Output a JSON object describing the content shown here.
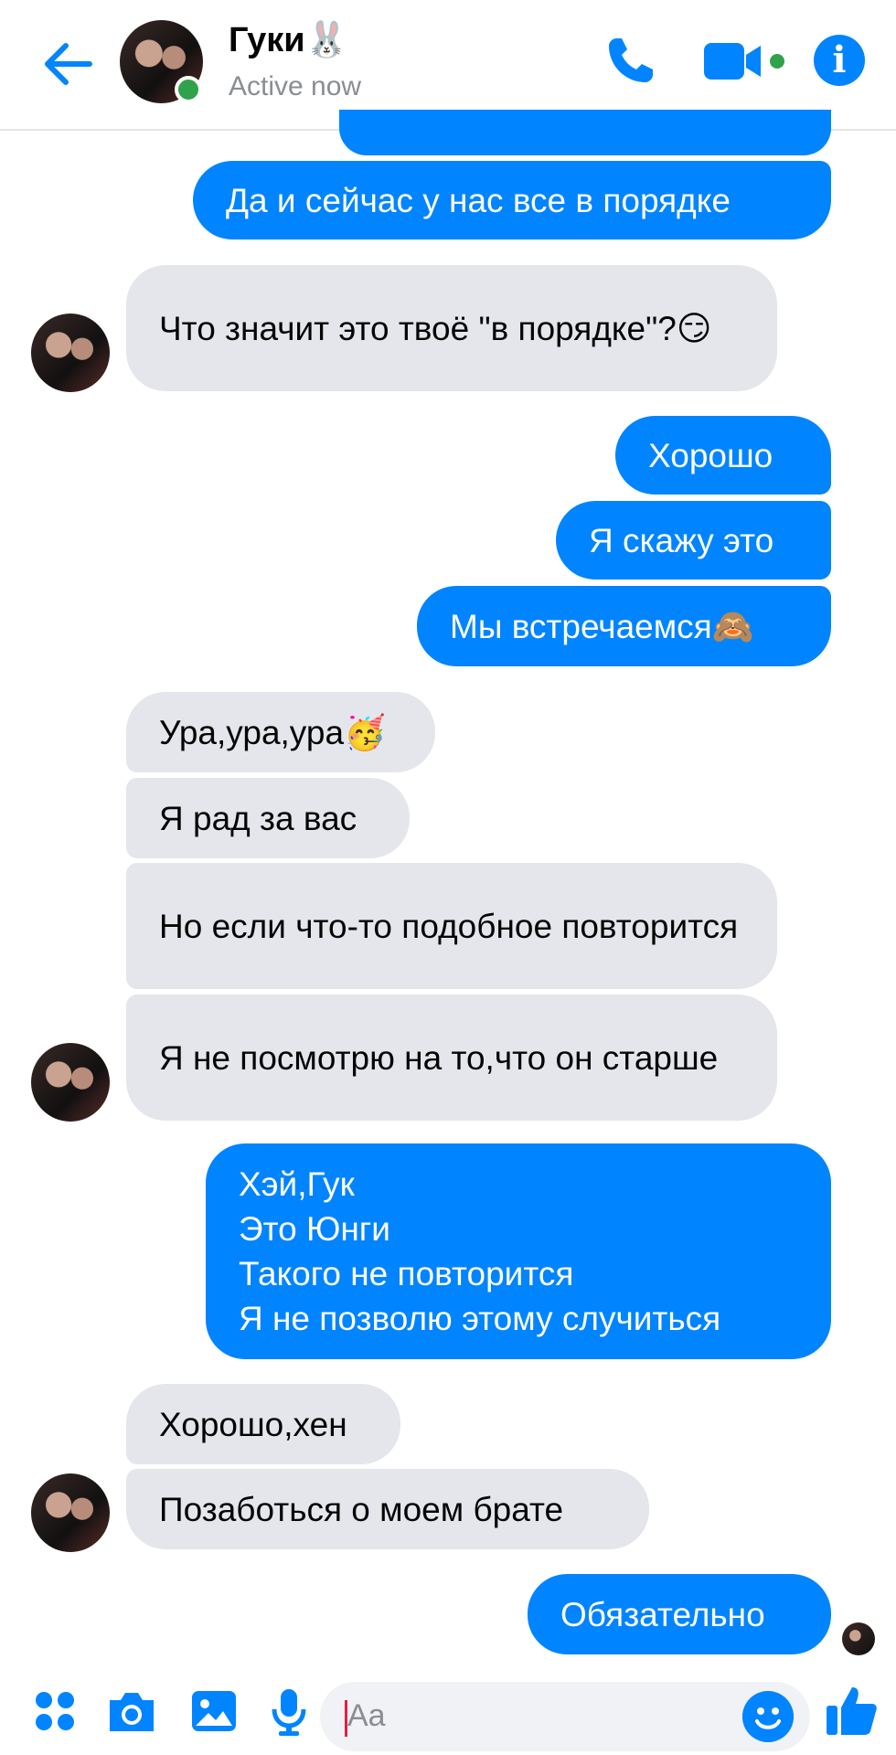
{
  "header": {
    "contact_name": "Гуки🐰",
    "status": "Active now",
    "info_glyph": "i",
    "icons": [
      "back-arrow-icon",
      "phone-icon",
      "video-camera-icon",
      "info-icon"
    ],
    "accent_color": "#0084ff",
    "online_color": "#31a24c"
  },
  "messages": [
    {
      "side": "out",
      "text": ""
    },
    {
      "side": "out",
      "text": "Да и сейчас у нас все в порядке"
    },
    {
      "side": "in",
      "text": "Что значит это твоё \"в порядке\"?😏"
    },
    {
      "side": "out",
      "text": "Хорошо"
    },
    {
      "side": "out",
      "text": "Я скажу это"
    },
    {
      "side": "out",
      "text": "Мы встречаемся🙈"
    },
    {
      "side": "in",
      "text": "Ура,ура,ура🥳"
    },
    {
      "side": "in",
      "text": "Я рад за вас"
    },
    {
      "side": "in",
      "text": "Но если что-то подобное повторится"
    },
    {
      "side": "in",
      "text": "Я не посмотрю на то,что он старше"
    },
    {
      "side": "out",
      "text": "Хэй,Гук\nЭто Юнги\nТакого не повторится\nЯ не позволю этому случиться"
    },
    {
      "side": "in",
      "text": "Хорошо,хен"
    },
    {
      "side": "in",
      "text": "Позаботься о моем брате"
    },
    {
      "side": "out",
      "text": "Обязательно"
    }
  ],
  "composer": {
    "placeholder": "Aa",
    "icons": [
      "apps-icon",
      "camera-icon",
      "gallery-icon",
      "microphone-icon",
      "emoji-icon",
      "thumbs-up-icon"
    ]
  },
  "colors": {
    "outgoing_bubble": "#0084ff",
    "incoming_bubble": "#e4e6eb"
  }
}
